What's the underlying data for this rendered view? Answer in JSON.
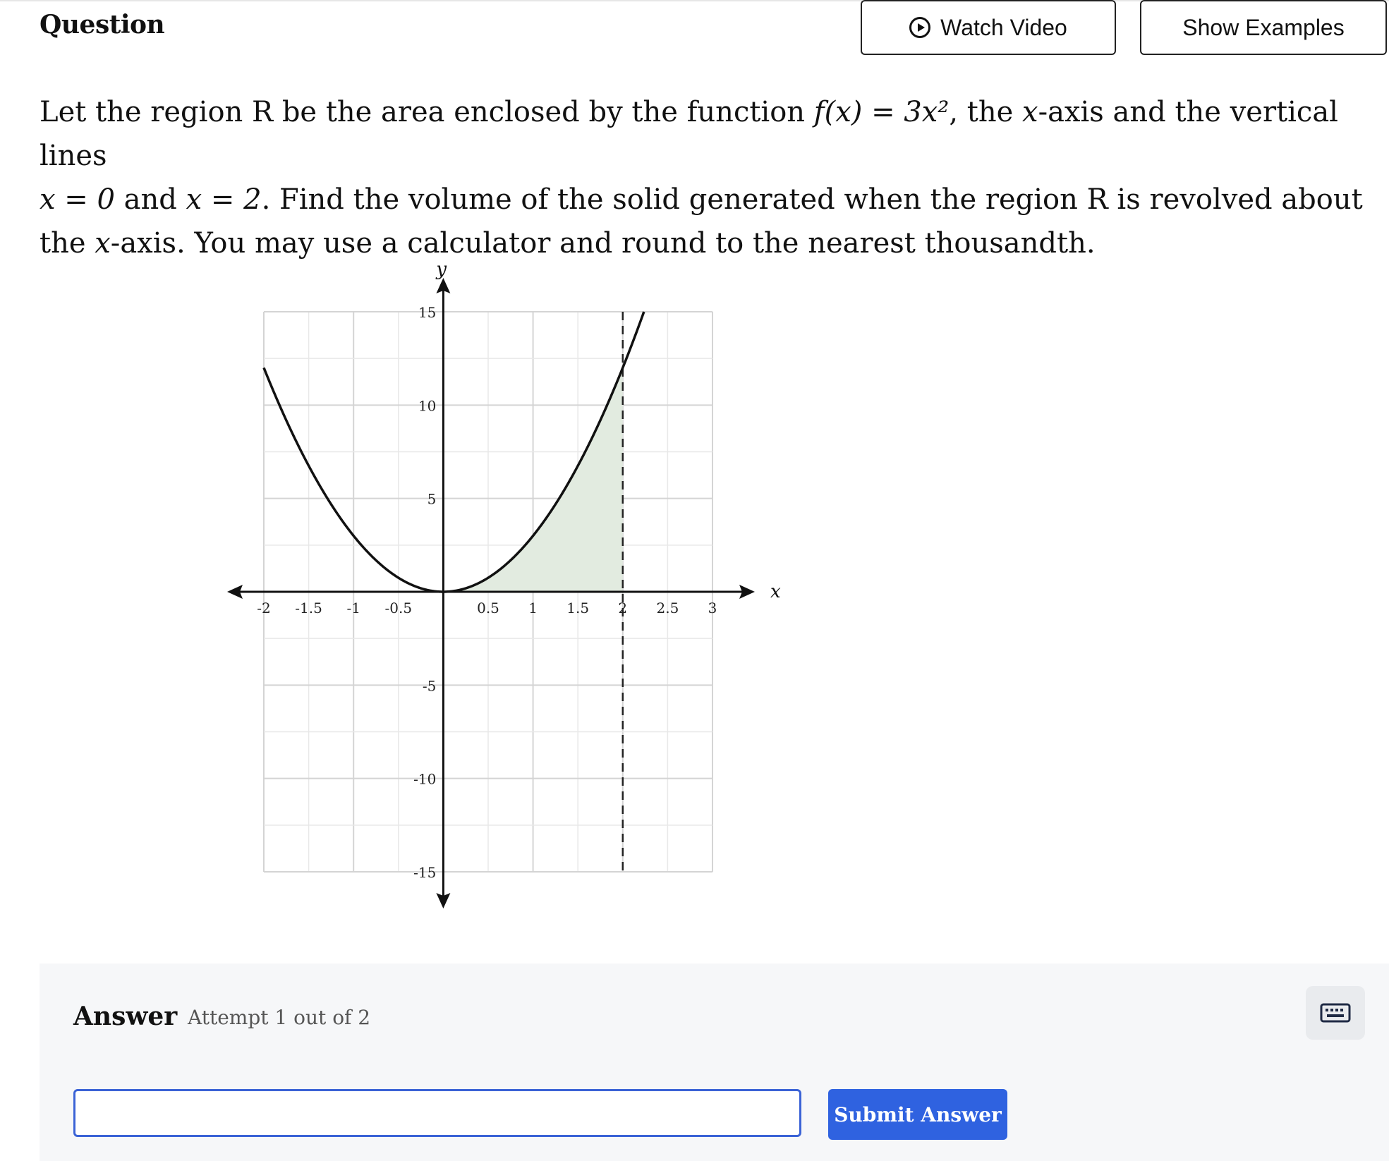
{
  "header": {
    "title": "Question",
    "watch_video_label": "Watch Video",
    "show_examples_label": "Show Examples"
  },
  "problem": {
    "p1": "Let the region R be the area enclosed by the function ",
    "m1": "f(x) = 3x²",
    "p2": ", the ",
    "m2": "x",
    "p3": "-axis and the vertical lines ",
    "m3": "x = 0",
    "p4": " and ",
    "m4": "x = 2",
    "p5": ". Find the volume of the solid generated when the region R is revolved about the ",
    "m5": "x",
    "p6": "-axis. You may use a calculator and round to the nearest thousandth."
  },
  "chart_data": {
    "type": "line",
    "function": "3x^2",
    "x_range": [
      -2,
      3
    ],
    "y_range": [
      -15,
      15
    ],
    "x_ticks": [
      "-2",
      "-1.5",
      "-1",
      "-0.5",
      "0.5",
      "1",
      "1.5",
      "2",
      "2.5",
      "3"
    ],
    "x_tick_values": [
      -2,
      -1.5,
      -1,
      -0.5,
      0.5,
      1,
      1.5,
      2,
      2.5,
      3
    ],
    "y_ticks": [
      "15",
      "10",
      "5",
      "-5",
      "-10",
      "-15"
    ],
    "y_tick_values": [
      15,
      10,
      5,
      -5,
      -10,
      -15
    ],
    "xlabel": "x",
    "ylabel": "y",
    "shaded_region": {
      "x_from": 0,
      "x_to": 2,
      "color": "#e2ebe0"
    },
    "vertical_dashed_line": 2,
    "grid": true
  },
  "answer": {
    "title": "Answer",
    "attempt": "Attempt 1 out of 2",
    "input_value": "",
    "submit_label": "Submit Answer"
  }
}
